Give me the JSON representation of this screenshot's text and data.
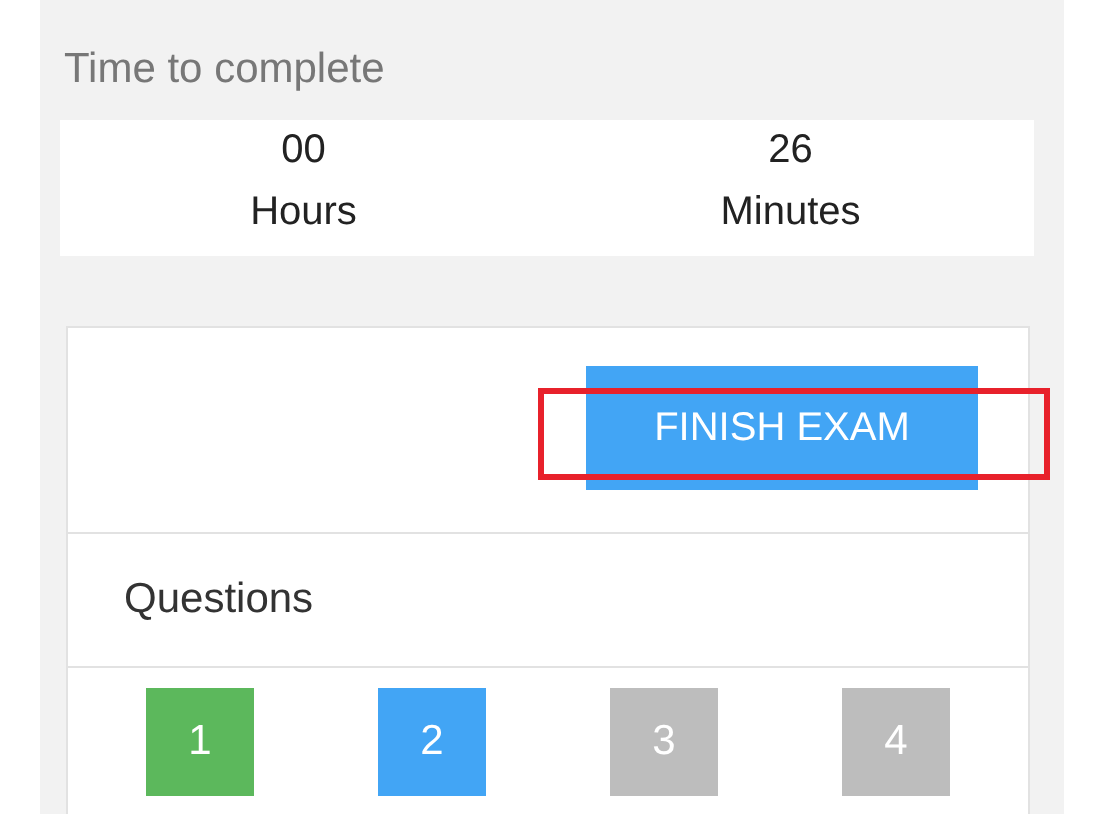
{
  "timer": {
    "title": "Time to complete",
    "units": [
      {
        "value": "00",
        "label": "Hours"
      },
      {
        "value": "26",
        "label": "Minutes"
      }
    ]
  },
  "finish_button": {
    "label": "FINISH EXAM",
    "highlighted": true
  },
  "questions": {
    "title": "Questions",
    "items": [
      {
        "number": "1",
        "color": "#5cb85c"
      },
      {
        "number": "2",
        "color": "#42a5f5"
      },
      {
        "number": "3",
        "color": "#bdbdbd"
      },
      {
        "number": "4",
        "color": "#bdbdbd"
      }
    ]
  }
}
